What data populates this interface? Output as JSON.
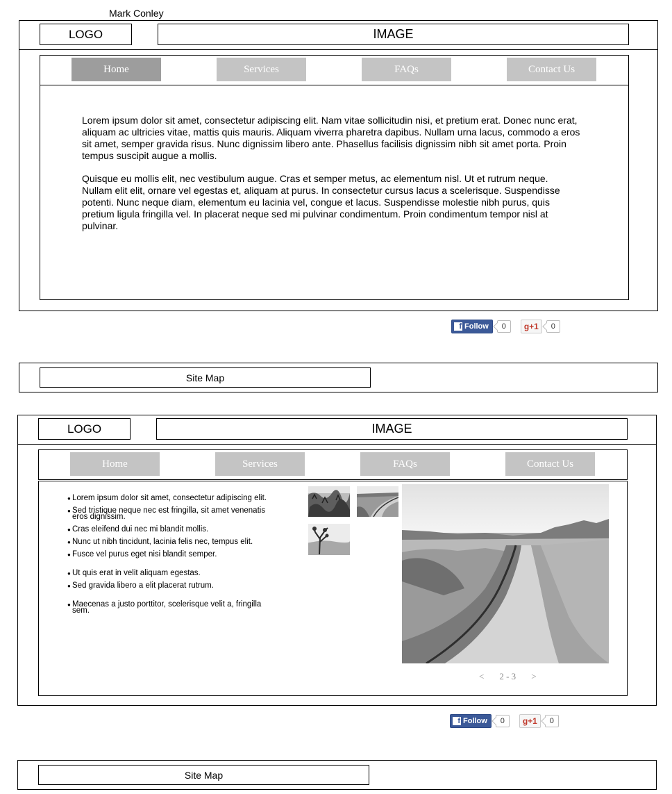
{
  "author": "Mark Conley",
  "page1": {
    "logo": "LOGO",
    "image": "IMAGE",
    "nav": [
      "Home",
      "Services",
      "FAQs",
      "Contact Us"
    ],
    "paragraphs": [
      "Lorem ipsum dolor sit amet, consectetur adipiscing elit. Nam vitae sollicitudin nisi, et pretium erat. Donec nunc erat, aliquam ac ultricies vitae, mattis quis mauris. Aliquam viverra pharetra dapibus. Nullam urna lacus, commodo a eros sit amet, semper gravida risus. Nunc dignissim libero ante. Phasellus facilisis dignissim nibh sit amet porta. Proin tempus suscipit augue a mollis.",
      "Quisque eu mollis elit, nec vestibulum augue. Cras et semper metus, ac elementum nisl. Ut et rutrum neque. Nullam elit elit, ornare vel egestas et, aliquam at purus. In consectetur cursus lacus a scelerisque. Suspendisse potenti. Nunc neque diam, elementum eu lacinia vel, congue et lacus. Suspendisse molestie nibh purus, quis pretium ligula fringilla vel. In placerat neque sed mi pulvinar condimentum. Proin condimentum tempor nisl at pulvinar."
    ],
    "social": {
      "fb_label": "Follow",
      "fb_logo": "f",
      "fb_count": "0",
      "gplus_label": "g+1",
      "gplus_count": "0"
    },
    "sitemap": "Site Map"
  },
  "page2": {
    "logo": "LOGO",
    "image": "IMAGE",
    "nav": [
      "Home",
      "Services",
      "FAQs",
      "Contact Us"
    ],
    "bullets": [
      "Lorem ipsum dolor sit amet, consectetur adipiscing elit.",
      "Sed tristique neque nec est fringilla, sit amet venenatis eros dignissim.",
      "Cras eleifend dui nec mi blandit mollis.",
      "Nunc ut nibh tincidunt, lacinia felis nec, tempus elit.",
      "Fusce vel purus eget nisi blandit semper.",
      "Ut quis erat in velit aliquam egestas.",
      "Sed gravida libero a elit placerat rutrum.",
      "Maecenas a justo porttitor, scelerisque velit a, fringilla sem."
    ],
    "pager": {
      "prev": "<",
      "range": "2 - 3",
      "next": ">"
    },
    "social": {
      "fb_label": "Follow",
      "fb_logo": "f",
      "fb_count": "0",
      "gplus_label": "g+1",
      "gplus_count": "0"
    },
    "sitemap": "Site Map"
  },
  "colors": {
    "nav_active": "#9d9d9d",
    "nav_inactive": "#c4c4c4",
    "facebook": "#3b5998",
    "gplus": "#c0392b"
  },
  "icons": [
    "facebook-icon",
    "google-plus-icon",
    "chevron-left-icon",
    "chevron-right-icon"
  ]
}
